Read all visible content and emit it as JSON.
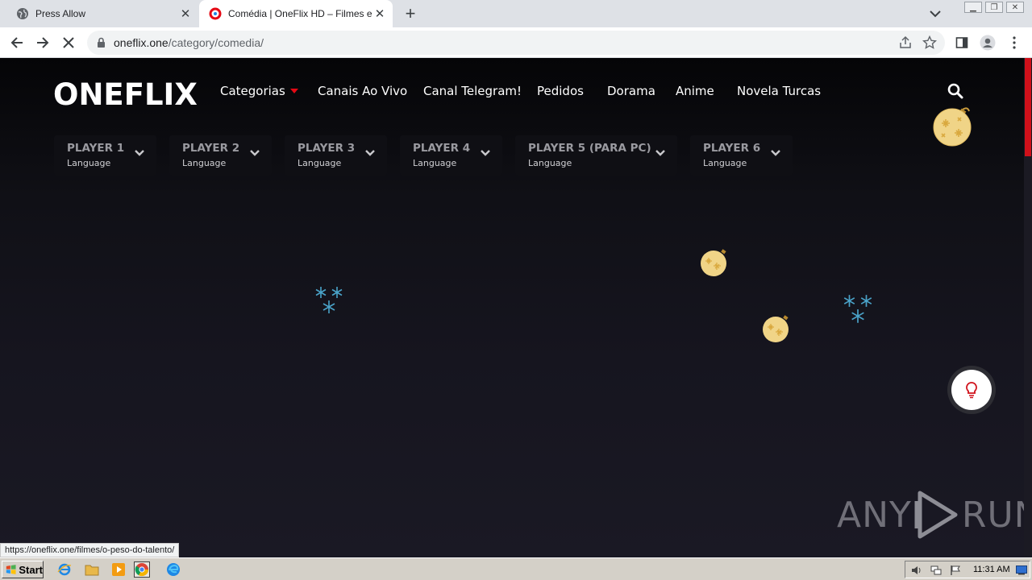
{
  "browser": {
    "tabs": [
      {
        "title": "Press Allow",
        "active": false
      },
      {
        "title": "Comédia | OneFlix HD – Filmes e Séries",
        "active": true
      }
    ],
    "url_host": "oneflix.one",
    "url_path": "/category/comedia/",
    "status_url": "https://oneflix.one/filmes/o-peso-do-talento/"
  },
  "site": {
    "logo": "ONEFLIX",
    "nav": [
      "Categorias",
      "Canais Ao Vivo",
      "Canal Telegram!",
      "Pedidos",
      "Dorama",
      "Anime",
      "Novela Turcas"
    ],
    "players": [
      {
        "name": "PLAYER 1",
        "language": "Language"
      },
      {
        "name": "PLAYER 2",
        "language": "Language"
      },
      {
        "name": "PLAYER 3",
        "language": "Language"
      },
      {
        "name": "PLAYER 4",
        "language": "Language"
      },
      {
        "name": "PLAYER 5 (PARA PC)",
        "language": "Language"
      },
      {
        "name": "PLAYER 6",
        "language": "Language"
      }
    ],
    "accent_color": "#e50914"
  },
  "watermark": {
    "left": "ANY",
    "right": "RUN"
  },
  "taskbar": {
    "start_label": "Start",
    "clock": "11:31 AM"
  }
}
